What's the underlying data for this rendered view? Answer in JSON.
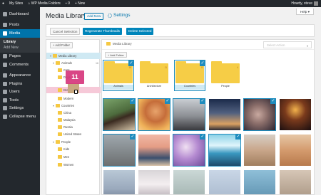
{
  "adminbar": {
    "my_sites": "My Sites",
    "site_name": "WP Media Folders",
    "comments_count": "0",
    "new_label": "+ New",
    "howdy": "Howdy, steve"
  },
  "menu": {
    "dashboard": "Dashboard",
    "posts": "Posts",
    "media": "Media",
    "library": "Library",
    "add_new": "Add New",
    "pages": "Pages",
    "comments": "Comments",
    "appearance": "Appearance",
    "plugins": "Plugins",
    "users": "Users",
    "tools": "Tools",
    "settings": "Settings",
    "collapse": "Collapse menu"
  },
  "header": {
    "title": "Media Library",
    "add_new": "Add New",
    "settings": "Settings",
    "help": "Help ▾"
  },
  "toolbar": {
    "cancel_selection": "Cancel Selection",
    "regenerate": "Regenerate Thumbnails",
    "delete_selected": "Delete Selected"
  },
  "tree": {
    "add_folder": "+ Add Folder",
    "root": "Media Library",
    "animals": "Animals",
    "animals_count": "16",
    "cats": "Cats",
    "dogs": "Dogs",
    "dragging": "Dragging",
    "modern": "Modern",
    "countries": "Countries",
    "china": "China",
    "malaysia": "Malaysia",
    "russia": "Russia",
    "united_states": "United States",
    "people": "People",
    "kids": "Kids",
    "men": "Men",
    "women": "Women"
  },
  "drag": {
    "count": "11"
  },
  "content": {
    "breadcrumb": "Media Library",
    "bulk_placeholder": "Select Action",
    "add_folder": "+ Add Folder",
    "folders": [
      {
        "label": "Animals",
        "count": "16"
      },
      {
        "label": "Architecture",
        "count": "11"
      },
      {
        "label": "Countries",
        "count": "8"
      },
      {
        "label": "People",
        "count": "4"
      }
    ]
  },
  "icons": {
    "check": "✓",
    "chevron": "▾"
  },
  "colors": {
    "admin_dark": "#23282d",
    "primary_blue": "#0085ba",
    "selection_blue": "#1e8cbe",
    "folder_yellow": "#f6cd46",
    "drag_pink": "#d6377c"
  }
}
